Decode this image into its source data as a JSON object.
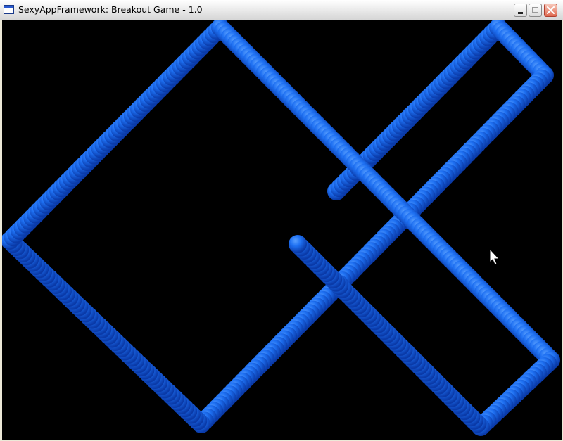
{
  "window": {
    "title": "SexyAppFramework: Breakout Game - 1.0",
    "icon": "app-window-icon",
    "buttons": [
      "minimize-icon",
      "maximize-icon",
      "close-icon"
    ]
  },
  "game": {
    "background_color": "#000000",
    "ball_color": "#1a6ef0",
    "cursor": "arrow-pointer-icon"
  }
}
